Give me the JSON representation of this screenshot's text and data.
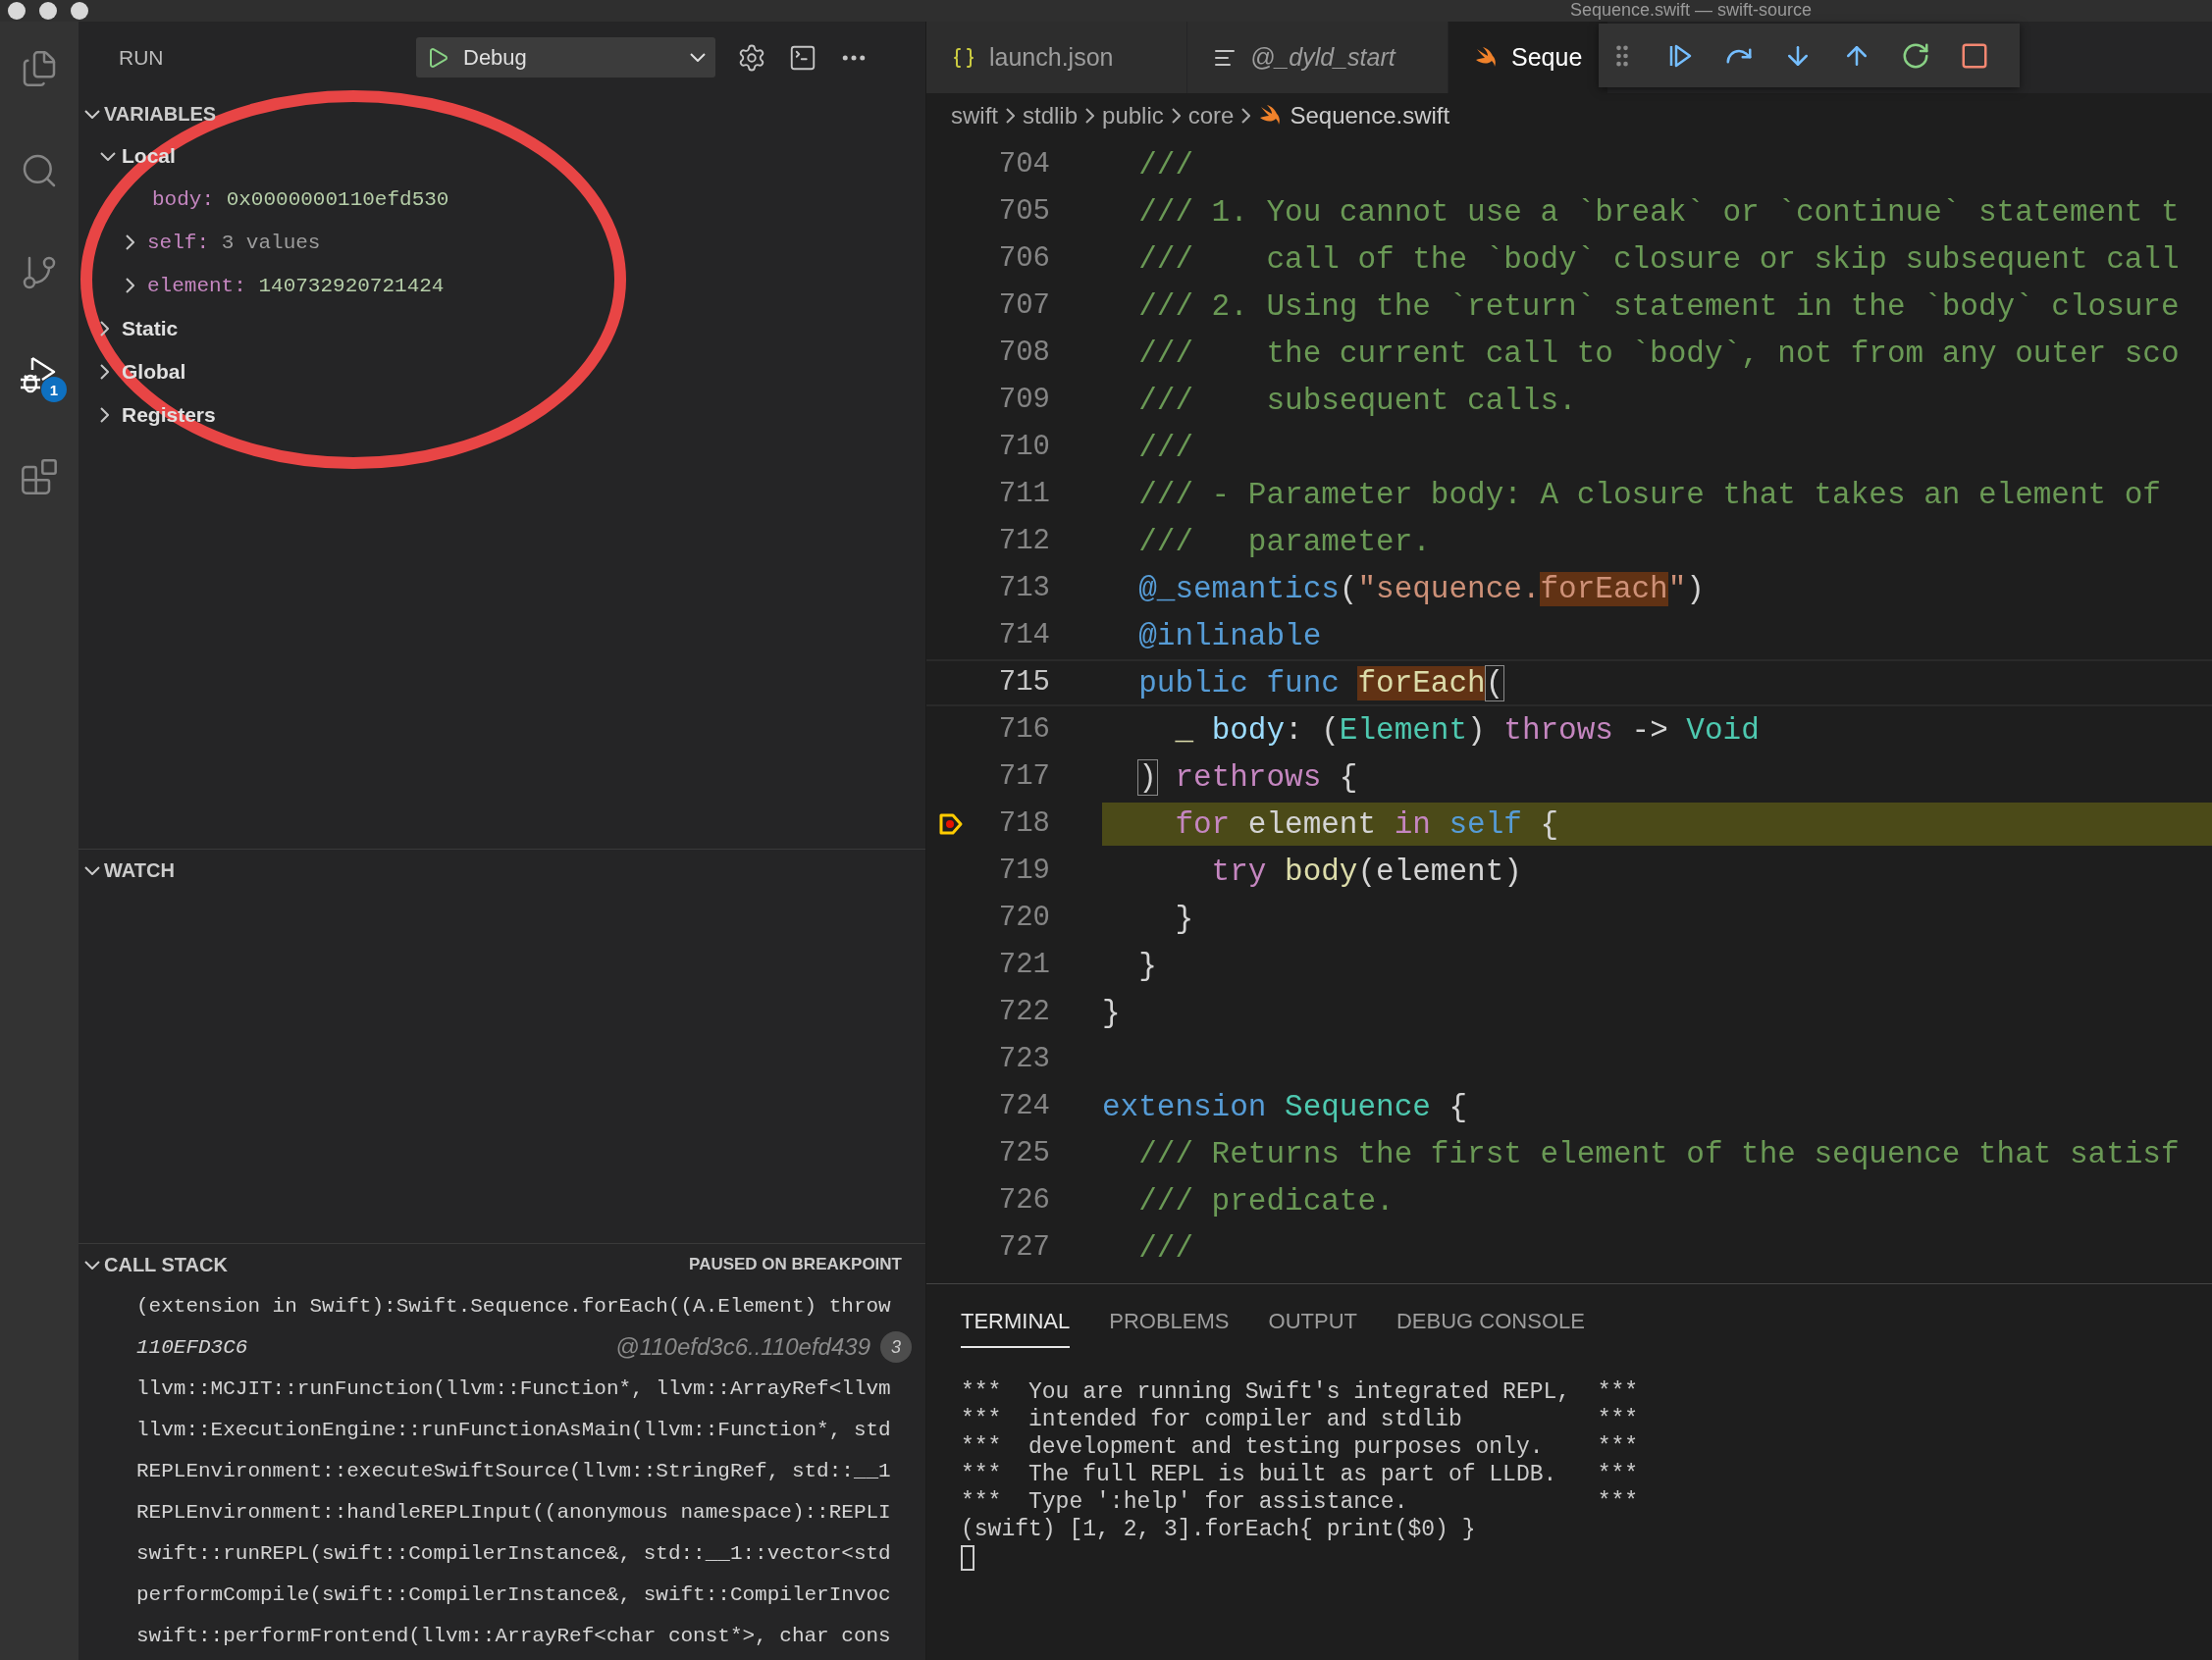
{
  "window": {
    "title": "Sequence.swift — swift-source"
  },
  "activity_bar": [
    {
      "selected": false
    },
    {
      "selected": false
    },
    {
      "selected": false
    },
    {
      "selected": true,
      "badge": "1"
    },
    {
      "selected": false
    }
  ],
  "sidebar": {
    "title": "RUN",
    "configuration": "Debug"
  },
  "variables": {
    "title": "VARIABLES",
    "expanded": true,
    "scopes": [
      {
        "label": "Local",
        "expanded": true,
        "children": [
          {
            "name": "body:",
            "value": "0x0000000110efd530",
            "kind": "value",
            "expandable": false
          },
          {
            "name": "self:",
            "value": "3 values",
            "kind": "summary",
            "expandable": true
          },
          {
            "name": "element:",
            "value": "140732920721424",
            "kind": "value",
            "expandable": true
          }
        ]
      },
      {
        "label": "Static",
        "expanded": false
      },
      {
        "label": "Global",
        "expanded": false
      },
      {
        "label": "Registers",
        "expanded": false
      }
    ]
  },
  "watch": {
    "title": "WATCH",
    "expanded": true
  },
  "call_stack": {
    "title": "CALL STACK",
    "expanded": true,
    "status": "PAUSED ON BREAKPOINT",
    "frames": [
      {
        "kind": "frame",
        "label": "(extension in Swift):Swift.Sequence.forEach((A.Element) throw"
      },
      {
        "kind": "disassembly",
        "label": "110EFD3C6",
        "address": "@110efd3c6..110efd439",
        "badge": "3"
      },
      {
        "kind": "frame",
        "label": "llvm::MCJIT::runFunction(llvm::Function*, llvm::ArrayRef<llvm"
      },
      {
        "kind": "frame",
        "label": "llvm::ExecutionEngine::runFunctionAsMain(llvm::Function*, std"
      },
      {
        "kind": "frame",
        "label": "REPLEnvironment::executeSwiftSource(llvm::StringRef, std::__1"
      },
      {
        "kind": "frame",
        "label": "REPLEnvironment::handleREPLInput((anonymous namespace)::REPLI"
      },
      {
        "kind": "frame",
        "label": "swift::runREPL(swift::CompilerInstance&, std::__1::vector<std"
      },
      {
        "kind": "frame",
        "label": "performCompile(swift::CompilerInstance&, swift::CompilerInvoc"
      },
      {
        "kind": "frame",
        "label": "swift::performFrontend(llvm::ArrayRef<char const*>, char cons"
      }
    ]
  },
  "editor": {
    "tabs": [
      {
        "label": "launch.json",
        "kind": "json",
        "selected": false,
        "italic": false
      },
      {
        "label": "@_dyld_start",
        "kind": "disassembly",
        "selected": false,
        "italic": true
      },
      {
        "label": "Seque",
        "kind": "swift",
        "selected": true,
        "italic": false
      }
    ],
    "breadcrumb": [
      {
        "label": "swift",
        "kind": "folder"
      },
      {
        "label": "stdlib",
        "kind": "folder"
      },
      {
        "label": "public",
        "kind": "folder"
      },
      {
        "label": "core",
        "kind": "folder"
      },
      {
        "label": "Sequence.swift",
        "kind": "file"
      }
    ],
    "lines": [
      {
        "number": "704",
        "active": false,
        "current": false,
        "tokens": [
          {
            "kind": "comment",
            "text": "  ///"
          }
        ]
      },
      {
        "number": "705",
        "active": false,
        "current": false,
        "tokens": [
          {
            "kind": "comment",
            "text": "  /// 1. You cannot use a `break` or `continue` statement t"
          }
        ]
      },
      {
        "number": "706",
        "active": false,
        "current": false,
        "tokens": [
          {
            "kind": "comment",
            "text": "  ///    call of the `body` closure or skip subsequent call"
          }
        ]
      },
      {
        "number": "707",
        "active": false,
        "current": false,
        "tokens": [
          {
            "kind": "comment",
            "text": "  /// 2. Using the `return` statement in the `body` closure"
          }
        ]
      },
      {
        "number": "708",
        "active": false,
        "current": false,
        "tokens": [
          {
            "kind": "comment",
            "text": "  ///    the current call to `body`, not from any outer sco"
          }
        ]
      },
      {
        "number": "709",
        "active": false,
        "current": false,
        "tokens": [
          {
            "kind": "comment",
            "text": "  ///    subsequent calls."
          }
        ]
      },
      {
        "number": "710",
        "active": false,
        "current": false,
        "tokens": [
          {
            "kind": "comment",
            "text": "  ///"
          }
        ]
      },
      {
        "number": "711",
        "active": false,
        "current": false,
        "tokens": [
          {
            "kind": "comment",
            "text": "  /// - Parameter body: A closure that takes an element of"
          }
        ]
      },
      {
        "number": "712",
        "active": false,
        "current": false,
        "tokens": [
          {
            "kind": "comment",
            "text": "  ///   parameter."
          }
        ]
      },
      {
        "number": "713",
        "active": false,
        "current": false,
        "tokens": [
          {
            "kind": "keyword",
            "text": "  @_semantics"
          },
          {
            "kind": "plain",
            "text": "("
          },
          {
            "kind": "string",
            "text": "\"sequence."
          },
          {
            "kind": "string-match",
            "text": "forEach"
          },
          {
            "kind": "string",
            "text": "\""
          },
          {
            "kind": "plain",
            "text": ")"
          }
        ]
      },
      {
        "number": "714",
        "active": false,
        "current": false,
        "tokens": [
          {
            "kind": "keyword",
            "text": "  @inlinable"
          }
        ]
      },
      {
        "number": "715",
        "active": true,
        "current": false,
        "tokens": [
          {
            "kind": "keyword",
            "text": "  public func "
          },
          {
            "kind": "function-match",
            "text": "forEach"
          },
          {
            "kind": "bracket-match",
            "text": "("
          }
        ]
      },
      {
        "number": "716",
        "active": false,
        "current": false,
        "tokens": [
          {
            "kind": "function",
            "text": "    _ "
          },
          {
            "kind": "parameter",
            "text": "body"
          },
          {
            "kind": "plain",
            "text": ": ("
          },
          {
            "kind": "type",
            "text": "Element"
          },
          {
            "kind": "plain",
            "text": ") "
          },
          {
            "kind": "control",
            "text": "throws"
          },
          {
            "kind": "plain",
            "text": " -> "
          },
          {
            "kind": "type",
            "text": "Void"
          }
        ]
      },
      {
        "number": "717",
        "active": false,
        "current": false,
        "tokens": [
          {
            "kind": "bracket-match",
            "text": "  )"
          },
          {
            "kind": "control",
            "text": " rethrows"
          },
          {
            "kind": "plain",
            "text": " {"
          }
        ]
      },
      {
        "number": "718",
        "active": false,
        "current": true,
        "breakpoint": true,
        "tokens": [
          {
            "kind": "control",
            "text": "    for"
          },
          {
            "kind": "plain",
            "text": " element "
          },
          {
            "kind": "control",
            "text": "in"
          },
          {
            "kind": "keyword",
            "text": " self"
          },
          {
            "kind": "plain",
            "text": " {"
          }
        ]
      },
      {
        "number": "719",
        "active": false,
        "current": false,
        "tokens": [
          {
            "kind": "control",
            "text": "      try"
          },
          {
            "kind": "function",
            "text": " body"
          },
          {
            "kind": "plain",
            "text": "(element)"
          }
        ]
      },
      {
        "number": "720",
        "active": false,
        "current": false,
        "tokens": [
          {
            "kind": "plain",
            "text": "    }"
          }
        ]
      },
      {
        "number": "721",
        "active": false,
        "current": false,
        "tokens": [
          {
            "kind": "plain",
            "text": "  }"
          }
        ]
      },
      {
        "number": "722",
        "active": false,
        "current": false,
        "tokens": [
          {
            "kind": "plain",
            "text": "}"
          }
        ]
      },
      {
        "number": "723",
        "active": false,
        "current": false
      },
      {
        "number": "724",
        "active": false,
        "current": false,
        "tokens": [
          {
            "kind": "keyword",
            "text": "extension"
          },
          {
            "kind": "type",
            "text": " Sequence"
          },
          {
            "kind": "plain",
            "text": " {"
          }
        ]
      },
      {
        "number": "725",
        "active": false,
        "current": false,
        "tokens": [
          {
            "kind": "comment",
            "text": "  /// Returns the first element of the sequence that satisf"
          }
        ]
      },
      {
        "number": "726",
        "active": false,
        "current": false,
        "tokens": [
          {
            "kind": "comment",
            "text": "  /// predicate."
          }
        ]
      },
      {
        "number": "727",
        "active": false,
        "current": false,
        "tokens": [
          {
            "kind": "comment",
            "text": "  ///"
          }
        ]
      }
    ]
  },
  "panel": {
    "tabs": [
      {
        "label": "TERMINAL",
        "selected": true
      },
      {
        "label": "PROBLEMS",
        "selected": false
      },
      {
        "label": "OUTPUT",
        "selected": false
      },
      {
        "label": "DEBUG CONSOLE",
        "selected": false
      }
    ],
    "terminal_lines": [
      "***  You are running Swift's integrated REPL,  ***",
      "***  intended for compiler and stdlib          ***",
      "***  development and testing purposes only.    ***",
      "***  The full REPL is built as part of LLDB.   ***",
      "***  Type ':help' for assistance.              ***",
      "(swift) [1, 2, 3].forEach{ print($0) }"
    ]
  },
  "annotation": {
    "kind": "ellipse"
  }
}
